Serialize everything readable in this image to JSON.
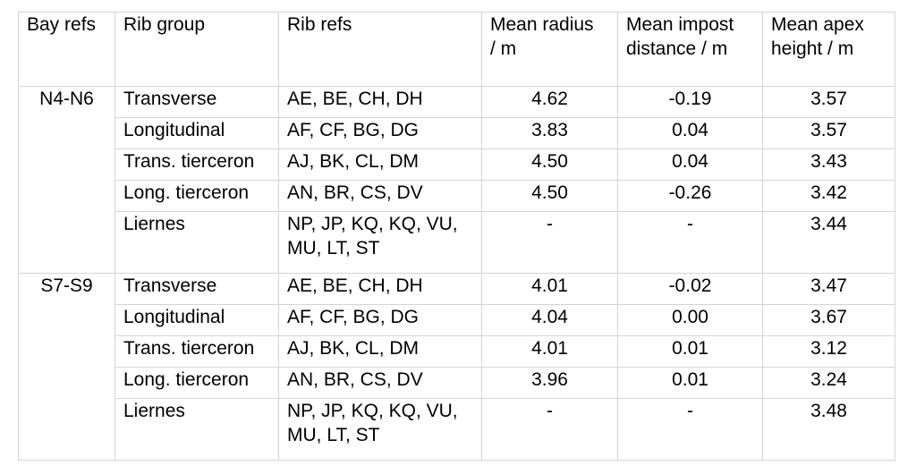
{
  "table": {
    "headers": [
      "Bay refs",
      "Rib group",
      "Rib refs",
      "Mean radius / m",
      "Mean impost distance / m",
      "Mean apex height / m"
    ],
    "header_lines": {
      "bay_refs": "Bay refs",
      "rib_group": "Rib group",
      "rib_refs": "Rib refs",
      "mean_radius": "Mean radius\n/ m",
      "mean_impost": "Mean impost\ndistance / m",
      "mean_apex": "Mean apex\nheight / m"
    },
    "blocks": [
      {
        "bay_ref": "N4-N6",
        "rows": [
          {
            "rib_group": "Transverse",
            "rib_refs": "AE, BE, CH, DH",
            "mean_radius": "4.62",
            "mean_impost_distance": "-0.19",
            "mean_apex_height": "3.57"
          },
          {
            "rib_group": "Longitudinal",
            "rib_refs": "AF, CF, BG, DG",
            "mean_radius": "3.83",
            "mean_impost_distance": "0.04",
            "mean_apex_height": "3.57"
          },
          {
            "rib_group": "Trans. tierceron",
            "rib_refs": "AJ, BK, CL, DM",
            "mean_radius": "4.50",
            "mean_impost_distance": "0.04",
            "mean_apex_height": "3.43"
          },
          {
            "rib_group": "Long. tierceron",
            "rib_refs": "AN, BR, CS, DV",
            "mean_radius": "4.50",
            "mean_impost_distance": "-0.26",
            "mean_apex_height": "3.42"
          },
          {
            "rib_group": "Liernes",
            "rib_refs": "NP, JP, KQ, KQ, VU,\nMU, LT, ST",
            "mean_radius": "-",
            "mean_impost_distance": "-",
            "mean_apex_height": "3.44"
          }
        ]
      },
      {
        "bay_ref": "S7-S9",
        "rows": [
          {
            "rib_group": "Transverse",
            "rib_refs": "AE, BE, CH, DH",
            "mean_radius": "4.01",
            "mean_impost_distance": "-0.02",
            "mean_apex_height": "3.47"
          },
          {
            "rib_group": "Longitudinal",
            "rib_refs": "AF, CF, BG, DG",
            "mean_radius": "4.04",
            "mean_impost_distance": "0.00",
            "mean_apex_height": "3.67"
          },
          {
            "rib_group": "Trans. tierceron",
            "rib_refs": "AJ, BK, CL, DM",
            "mean_radius": "4.01",
            "mean_impost_distance": "0.01",
            "mean_apex_height": "3.12"
          },
          {
            "rib_group": "Long. tierceron",
            "rib_refs": "AN, BR, CS, DV",
            "mean_radius": "3.96",
            "mean_impost_distance": "0.01",
            "mean_apex_height": "3.24"
          },
          {
            "rib_group": "Liernes",
            "rib_refs": "NP, JP, KQ, KQ, VU,\nMU, LT, ST",
            "mean_radius": "-",
            "mean_impost_distance": "-",
            "mean_apex_height": "3.48"
          }
        ]
      }
    ]
  }
}
